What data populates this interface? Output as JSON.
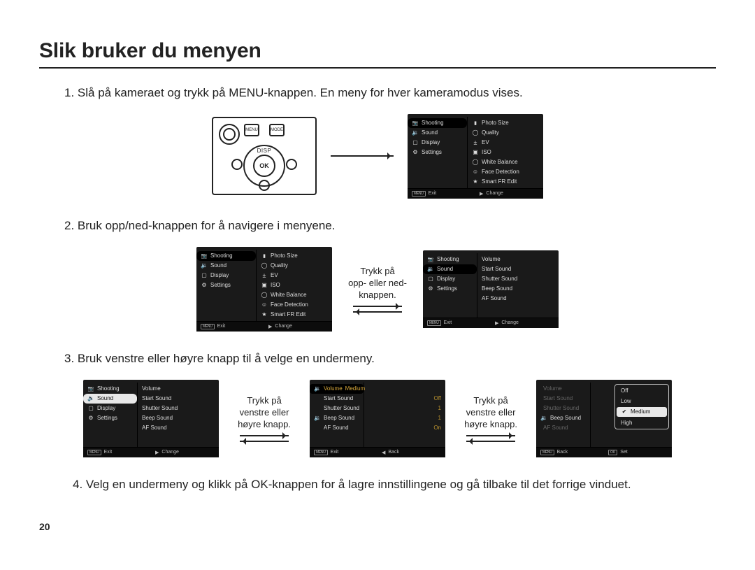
{
  "title": "Slik bruker du menyen",
  "page_number": "20",
  "steps": {
    "s1": "1. Slå på kameraet og trykk på MENU-knappen. En meny for hver kameramodus vises.",
    "s2": "2. Bruk opp/ned-knappen for å navigere i menyene.",
    "s3": "3. Bruk venstre eller høyre knapp til å velge en undermeny.",
    "s4": "4. Velg en undermeny og klikk på OK-knappen for å lagre innstillingene og gå tilbake til det forrige vinduet."
  },
  "captions": {
    "updown": "Trykk på\nopp- eller ned-\nknappen.",
    "lr1": "Trykk på\nvenstre eller\nhøyre knapp.",
    "lr2": "Trykk på\nvenstre eller\nhøyre knapp."
  },
  "camera": {
    "menu": "MENU",
    "mode": "MODE",
    "ok": "OK",
    "disp": "DISP"
  },
  "footer_labels": {
    "menu": "MENU",
    "ok": "OK",
    "exit": "Exit",
    "change": "Change",
    "back": "Back",
    "set": "Set"
  },
  "menu_left_main": [
    {
      "icon": "cam",
      "label": "Shooting"
    },
    {
      "icon": "spk",
      "label": "Sound"
    },
    {
      "icon": "disp",
      "label": "Display"
    },
    {
      "icon": "gear",
      "label": "Settings"
    }
  ],
  "shooting_right": [
    {
      "icon": "flag",
      "label": "Photo Size"
    },
    {
      "icon": "circle",
      "label": "Quality"
    },
    {
      "icon": "ev",
      "label": "EV"
    },
    {
      "icon": "iso",
      "label": "ISO"
    },
    {
      "icon": "circle",
      "label": "White Balance"
    },
    {
      "icon": "face",
      "label": "Face Detection"
    },
    {
      "icon": "star",
      "label": "Smart FR Edit"
    }
  ],
  "sound_right": [
    {
      "label": "Volume"
    },
    {
      "label": "Start Sound"
    },
    {
      "label": "Shutter Sound"
    },
    {
      "label": "Beep Sound"
    },
    {
      "label": "AF Sound"
    }
  ],
  "sound_values_header": "Volume",
  "sound_values_header_val": "Medium",
  "sound_values": [
    {
      "label": "Start Sound",
      "val": "Off"
    },
    {
      "label": "Shutter Sound",
      "val": "1"
    },
    {
      "label": "Beep Sound",
      "val": "1"
    },
    {
      "label": "AF Sound",
      "val": "On"
    }
  ],
  "volume_popup_left": [
    {
      "label": "Volume"
    },
    {
      "label": "Start Sound"
    },
    {
      "label": "Shutter Sound"
    },
    {
      "label": "Beep Sound"
    },
    {
      "label": "AF Sound"
    }
  ],
  "volume_popup_left_icon": "spk",
  "volume_options": [
    {
      "label": "Off",
      "sel": false
    },
    {
      "label": "Low",
      "sel": false
    },
    {
      "label": "Medium",
      "sel": true
    },
    {
      "label": "High",
      "sel": false
    }
  ]
}
